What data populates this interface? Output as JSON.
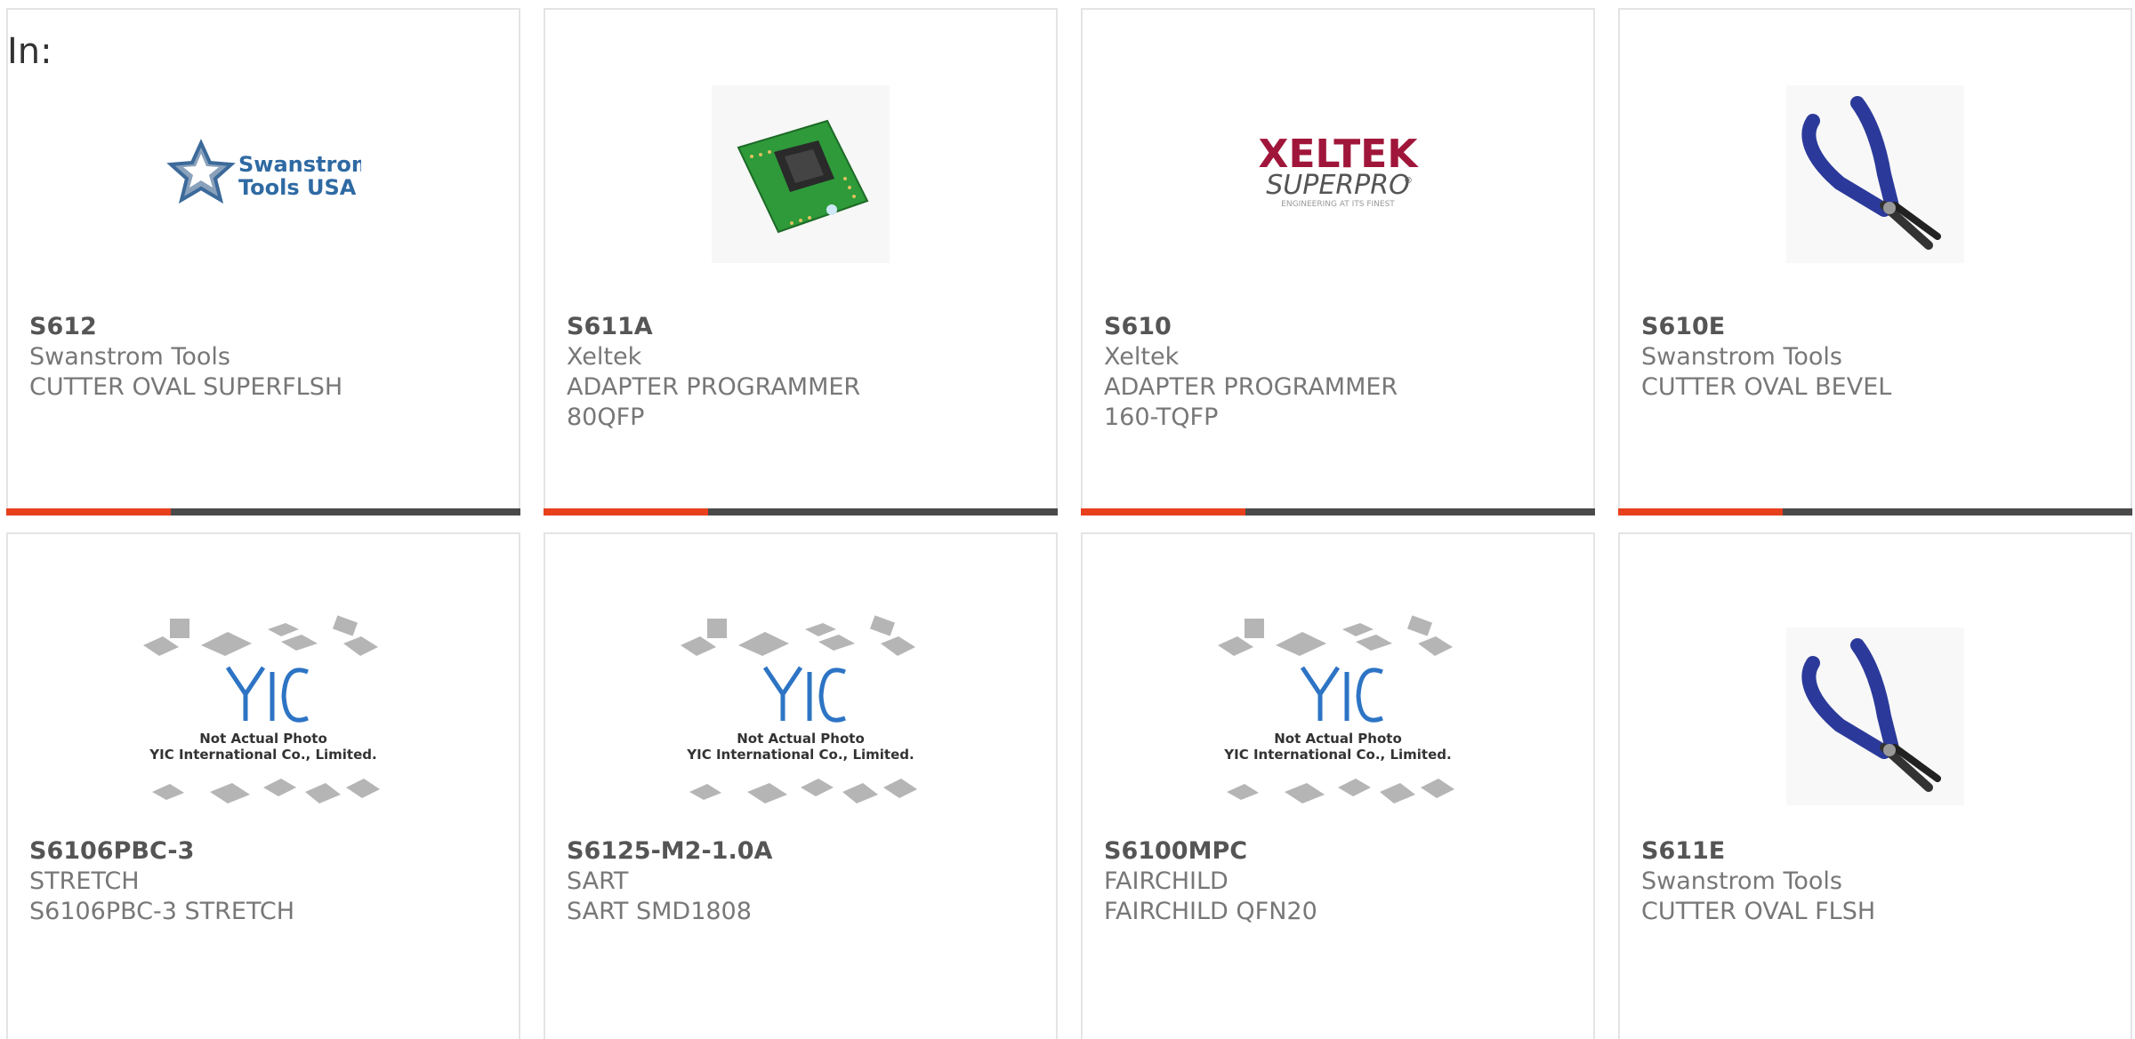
{
  "header": {
    "in_label": "In:"
  },
  "accent_color": "#e8401c",
  "bar_color": "#4a4a4a",
  "products": [
    {
      "part": "S612",
      "manufacturer": "Swanstrom Tools",
      "description": "CUTTER OVAL SUPERFLSH",
      "image": "swanstrom-logo",
      "logo_text": [
        "Swanstrom",
        "Tools USA"
      ],
      "bar_progress": 0.32
    },
    {
      "part": "S611A",
      "manufacturer": "Xeltek",
      "description": "ADAPTER PROGRAMMER 80QFP",
      "image": "adapter-board-photo",
      "bar_progress": 0.32
    },
    {
      "part": "S610",
      "manufacturer": "Xeltek",
      "description": "ADAPTER PROGRAMMER 160-TQFP",
      "image": "xeltek-logo",
      "logo_text": [
        "XELTEK",
        "SUPERPRO",
        "®",
        "ENGINEERING AT ITS FINEST"
      ],
      "bar_progress": 0.32
    },
    {
      "part": "S610E",
      "manufacturer": "Swanstrom Tools",
      "description": "CUTTER OVAL BEVEL",
      "image": "cutter-pliers-photo",
      "bar_progress": 0.32
    },
    {
      "part": "S6106PBC-3",
      "manufacturer": "STRETCH",
      "description": "S6106PBC-3 STRETCH",
      "image": "yic-placeholder",
      "placeholder_text": [
        "Not Actual Photo",
        "YIC International Co., Limited."
      ]
    },
    {
      "part": "S6125-M2-1.0A",
      "manufacturer": "SART",
      "description": "SART SMD1808",
      "image": "yic-placeholder",
      "placeholder_text": [
        "Not Actual Photo",
        "YIC International Co., Limited."
      ]
    },
    {
      "part": "S6100MPC",
      "manufacturer": "FAIRCHILD",
      "description": "FAIRCHILD QFN20",
      "image": "yic-placeholder",
      "placeholder_text": [
        "Not Actual Photo",
        "YIC International Co., Limited."
      ]
    },
    {
      "part": "S611E",
      "manufacturer": "Swanstrom Tools",
      "description": "CUTTER OVAL FLSH",
      "image": "cutter-pliers-photo"
    }
  ]
}
